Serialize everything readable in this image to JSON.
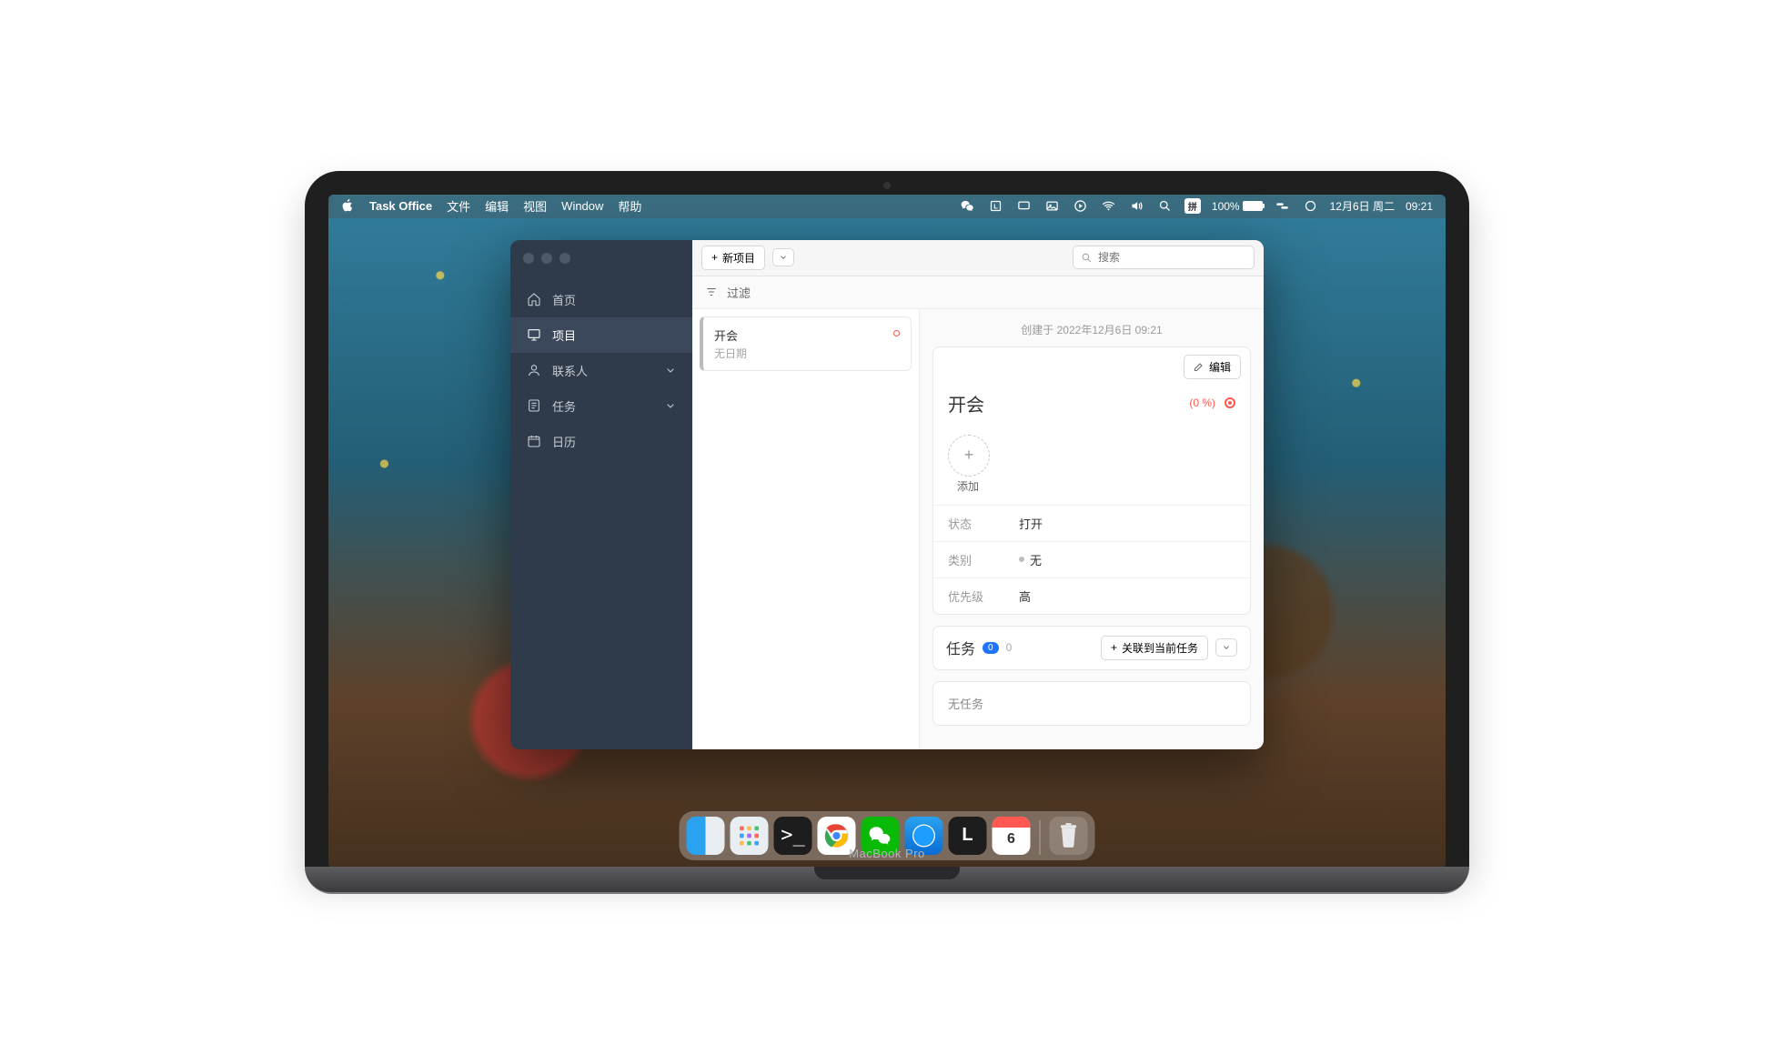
{
  "menubar": {
    "app_name": "Task Office",
    "items": [
      "文件",
      "编辑",
      "视图",
      "Window",
      "帮助"
    ],
    "input_method": "拼",
    "battery_pct": "100%",
    "date": "12月6日 周二",
    "time": "09:21"
  },
  "sidebar": {
    "items": [
      {
        "icon": "home",
        "label": "首页"
      },
      {
        "icon": "project",
        "label": "项目",
        "active": true
      },
      {
        "icon": "contact",
        "label": "联系人",
        "chev": true
      },
      {
        "icon": "task",
        "label": "任务",
        "chev": true
      },
      {
        "icon": "calendar",
        "label": "日历"
      }
    ]
  },
  "toolbar": {
    "new_project": "新项目",
    "search_placeholder": "搜索"
  },
  "filter": {
    "label": "过滤"
  },
  "list": {
    "items": [
      {
        "title": "开会",
        "sub": "无日期",
        "red": true
      }
    ]
  },
  "detail": {
    "created_prefix": "创建于",
    "created_value": "2022年12月6日 09:21",
    "edit": "编辑",
    "title": "开会",
    "progress": "(0 %)",
    "add": "添加",
    "rows": [
      {
        "k": "状态",
        "v": "打开"
      },
      {
        "k": "类别",
        "v": "无",
        "dot": true
      },
      {
        "k": "优先级",
        "v": "高"
      }
    ],
    "tasks_label": "任务",
    "tasks_count": "0",
    "tasks_zero": "0",
    "link_task": "关联到当前任务",
    "empty": "无任务"
  },
  "dock": {
    "calendar_day": "6"
  },
  "laptop_brand": "MacBook Pro"
}
